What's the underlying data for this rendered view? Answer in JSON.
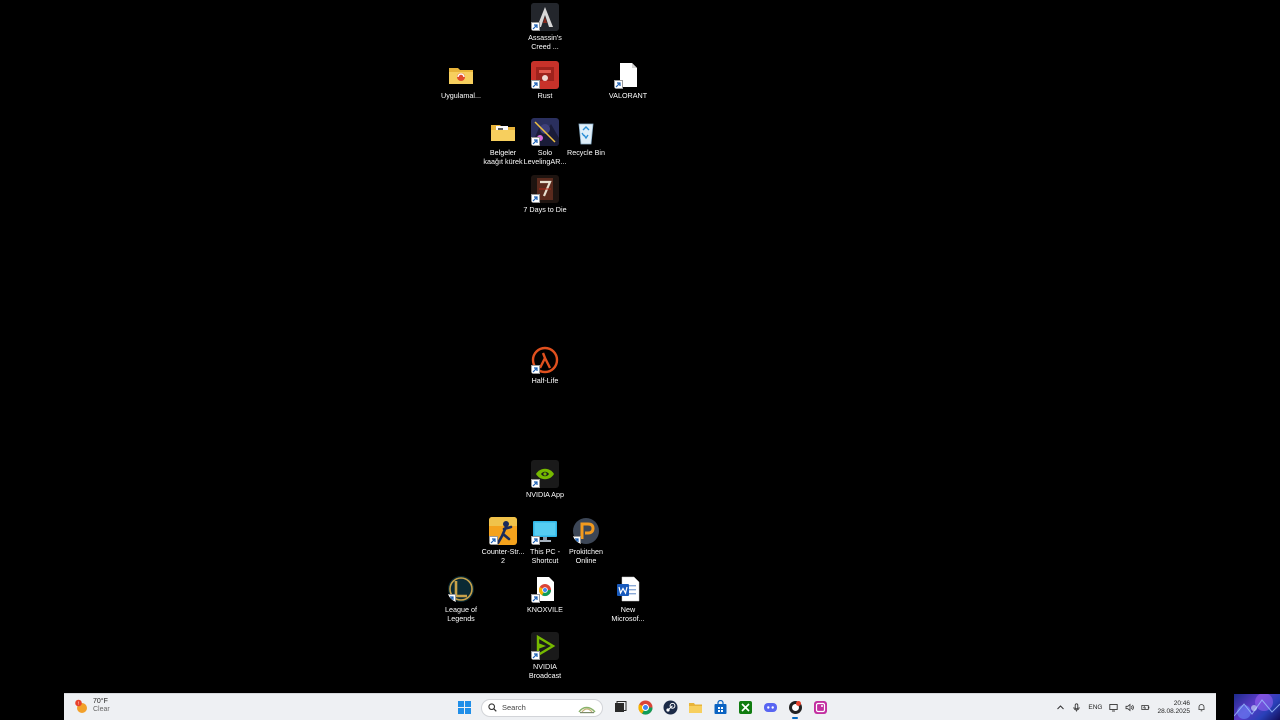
{
  "desktop": {
    "icons": [
      {
        "id": "assassins-creed",
        "label": "Assassin's\nCreed ...",
        "shortcut": true,
        "icon": "assassins-creed-icon"
      },
      {
        "id": "uygulamalar",
        "label": "Uygulamal...",
        "shortcut": false,
        "icon": "folder-icon"
      },
      {
        "id": "rust",
        "label": "Rust",
        "shortcut": true,
        "icon": "rust-icon"
      },
      {
        "id": "valorant",
        "label": "VALORANT",
        "shortcut": true,
        "icon": "blank-file-icon"
      },
      {
        "id": "belgeler",
        "label": "Belgeler\nkaağıt kürek",
        "shortcut": false,
        "icon": "folder-icon"
      },
      {
        "id": "solo-leveling",
        "label": "Solo\nLevelingAR...",
        "shortcut": true,
        "icon": "solo-leveling-icon"
      },
      {
        "id": "recycle-bin",
        "label": "Recycle Bin",
        "shortcut": false,
        "icon": "recycle-bin-icon"
      },
      {
        "id": "seven-days",
        "label": "7 Days to Die",
        "shortcut": true,
        "icon": "seven-days-to-die-icon"
      },
      {
        "id": "half-life",
        "label": "Half-Life",
        "shortcut": true,
        "icon": "half-life-icon"
      },
      {
        "id": "nvidia-app",
        "label": "NVIDIA App",
        "shortcut": true,
        "icon": "nvidia-icon"
      },
      {
        "id": "counter-strike",
        "label": "Counter-Str...\n2",
        "shortcut": true,
        "icon": "counter-strike-icon"
      },
      {
        "id": "this-pc",
        "label": "This PC -\nShortcut",
        "shortcut": true,
        "icon": "monitor-icon"
      },
      {
        "id": "prokitchen",
        "label": "Prokitchen\nOnline",
        "shortcut": true,
        "icon": "prokitchen-icon"
      },
      {
        "id": "league",
        "label": "League of\nLegends",
        "shortcut": true,
        "icon": "league-of-legends-icon"
      },
      {
        "id": "knoxvile",
        "label": "KNOXVILE",
        "shortcut": true,
        "icon": "chrome-file-icon"
      },
      {
        "id": "new-word",
        "label": "New\nMicrosof...",
        "shortcut": false,
        "icon": "word-document-icon"
      },
      {
        "id": "nvidia-broadcast",
        "label": "NVIDIA\nBroadcast",
        "shortcut": true,
        "icon": "nvidia-broadcast-icon"
      }
    ]
  },
  "taskbar": {
    "weather": {
      "temp": "70°F",
      "condition": "Clear",
      "badge": "!"
    },
    "search": {
      "label": "Search"
    },
    "apps": [
      {
        "name": "start-button",
        "icon": "windows-icon"
      },
      {
        "name": "task-view-button",
        "icon": "task-view-icon"
      },
      {
        "name": "chrome-button",
        "icon": "chrome-icon"
      },
      {
        "name": "steam-button",
        "icon": "steam-icon"
      },
      {
        "name": "file-explorer-button",
        "icon": "folder-icon"
      },
      {
        "name": "microsoft-store-button",
        "icon": "store-icon"
      },
      {
        "name": "xbox-button",
        "icon": "xbox-icon"
      },
      {
        "name": "discord-button",
        "icon": "discord-icon"
      },
      {
        "name": "recorder-button",
        "icon": "recorder-icon",
        "active": true
      },
      {
        "name": "photos-button",
        "icon": "photos-icon"
      }
    ],
    "tray": {
      "language": "ENG",
      "time": "20:46",
      "date": "28.08.2025"
    }
  },
  "colors": {
    "desktop_bg": "#000000",
    "taskbar_bg": "#eef0f3",
    "accent": "#0067c0"
  }
}
